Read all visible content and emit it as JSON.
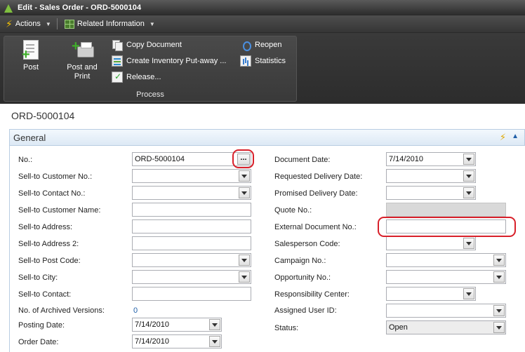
{
  "window": {
    "title": "Edit - Sales Order - ORD-5000104"
  },
  "menu": {
    "actions_label": "Actions",
    "related_label": "Related Information"
  },
  "ribbon": {
    "post_label": "Post",
    "post_print_label_line1": "Post and",
    "post_print_label_line2": "Print",
    "copy_document_label": "Copy Document",
    "create_inventory_label": "Create Inventory Put-away ...",
    "release_label": "Release...",
    "reopen_label": "Reopen",
    "statistics_label": "Statistics",
    "group_label": "Process"
  },
  "page": {
    "title": "ORD-5000104"
  },
  "section": {
    "title": "General"
  },
  "fields": {
    "no": {
      "label": "No.:",
      "value": "ORD-5000104"
    },
    "sell_to_customer_no": {
      "label": "Sell-to Customer No.:",
      "value": ""
    },
    "sell_to_contact_no": {
      "label": "Sell-to Contact No.:",
      "value": ""
    },
    "sell_to_customer_name": {
      "label": "Sell-to Customer Name:",
      "value": ""
    },
    "sell_to_address": {
      "label": "Sell-to Address:",
      "value": ""
    },
    "sell_to_address_2": {
      "label": "Sell-to Address 2:",
      "value": ""
    },
    "sell_to_post_code": {
      "label": "Sell-to Post Code:",
      "value": ""
    },
    "sell_to_city": {
      "label": "Sell-to City:",
      "value": ""
    },
    "sell_to_contact": {
      "label": "Sell-to Contact:",
      "value": ""
    },
    "archived_versions": {
      "label": "No. of Archived Versions:",
      "value": "0"
    },
    "posting_date": {
      "label": "Posting Date:",
      "value": "7/14/2010"
    },
    "order_date": {
      "label": "Order Date:",
      "value": "7/14/2010"
    },
    "document_date": {
      "label": "Document Date:",
      "value": "7/14/2010"
    },
    "requested_delivery_date": {
      "label": "Requested Delivery Date:",
      "value": ""
    },
    "promised_delivery_date": {
      "label": "Promised Delivery Date:",
      "value": ""
    },
    "quote_no": {
      "label": "Quote No.:",
      "value": ""
    },
    "external_document_no": {
      "label": "External Document No.:",
      "value": ""
    },
    "salesperson_code": {
      "label": "Salesperson Code:",
      "value": ""
    },
    "campaign_no": {
      "label": "Campaign No.:",
      "value": ""
    },
    "opportunity_no": {
      "label": "Opportunity No.:",
      "value": ""
    },
    "responsibility_center": {
      "label": "Responsibility Center:",
      "value": ""
    },
    "assigned_user_id": {
      "label": "Assigned User ID:",
      "value": ""
    },
    "status": {
      "label": "Status:",
      "value": "Open"
    }
  },
  "colors": {
    "highlight": "#d8202a",
    "link": "#1f5fa8",
    "section_bg": "#dde9f5"
  },
  "icons": [
    "actions-bolt-icon",
    "related-grid-icon",
    "post-icon",
    "post-print-icon",
    "copy-document-icon",
    "inventory-icon",
    "release-icon",
    "reopen-icon",
    "statistics-icon"
  ]
}
